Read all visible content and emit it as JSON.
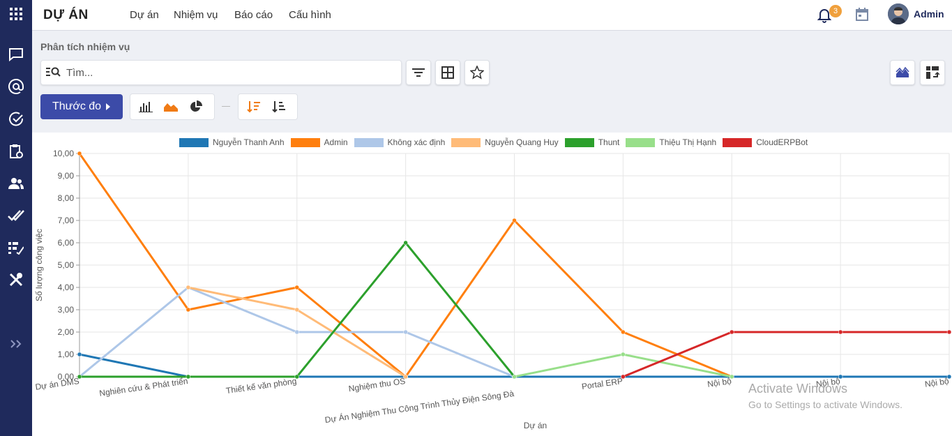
{
  "app": {
    "title": "DỰ ÁN",
    "menu": [
      "Dự án",
      "Nhiệm vụ",
      "Báo cáo",
      "Cấu hình"
    ],
    "notifications": "3",
    "user": "Admin"
  },
  "sidebar": {
    "icons": [
      "apps-grid-icon",
      "chat-icon",
      "at-sign-icon",
      "check-circle-icon",
      "clipboard-clock-icon",
      "users-icon",
      "double-check-icon",
      "task-list-icon",
      "tools-icon",
      "expand-chevrons-icon"
    ]
  },
  "control": {
    "breadcrumb": "Phân tích nhiệm vụ",
    "search_placeholder": "Tìm...",
    "measure_label": "Thước đo"
  },
  "watermark": {
    "line1": "Activate Windows",
    "line2": "Go to Settings to activate Windows."
  },
  "colors": {
    "accent": "#3c4ba8",
    "sidebar": "#1f2a5c",
    "badge": "#f0a03c"
  },
  "chart_data": {
    "type": "line",
    "xlabel": "Dự án",
    "ylabel": "Số lượng công việc",
    "ylim": [
      0,
      10
    ],
    "yticks": [
      "0,00",
      "1,00",
      "2,00",
      "3,00",
      "4,00",
      "5,00",
      "6,00",
      "7,00",
      "8,00",
      "9,00",
      "10,00"
    ],
    "categories": [
      "Dự án DMS",
      "Nghiên cứu & Phát triển",
      "Thiết kế văn phòng",
      "Nghiệm thu OS",
      "Dự Án Nghiệm Thu Công Trình Thủy Điện Sông Đà",
      "Portal ERP",
      "Nội bộ",
      "Nội bộ",
      "Nội bộ"
    ],
    "legend_position": "top",
    "grid": true,
    "series": [
      {
        "name": "Nguyễn Thanh Anh",
        "color": "#1f77b4",
        "values": [
          1,
          0,
          0,
          0,
          0,
          0,
          0,
          0,
          0
        ]
      },
      {
        "name": "Admin",
        "color": "#ff7f0e",
        "values": [
          10,
          3,
          4,
          0,
          7,
          2,
          0,
          null,
          null
        ]
      },
      {
        "name": "Không xác định",
        "color": "#aec7e8",
        "values": [
          0,
          4,
          2,
          2,
          0,
          null,
          null,
          null,
          null
        ]
      },
      {
        "name": "Nguyễn Quang Huy",
        "color": "#ffbb78",
        "values": [
          null,
          4,
          3,
          0,
          null,
          null,
          null,
          null,
          null
        ]
      },
      {
        "name": "Thunt",
        "color": "#2ca02c",
        "values": [
          0,
          0,
          0,
          6,
          0,
          null,
          null,
          null,
          null
        ]
      },
      {
        "name": "Thiệu Thị Hạnh",
        "color": "#98df8a",
        "values": [
          null,
          null,
          null,
          null,
          0,
          1,
          0,
          null,
          null
        ]
      },
      {
        "name": "CloudERPBot",
        "color": "#d62728",
        "values": [
          null,
          null,
          null,
          null,
          null,
          0,
          2,
          2,
          2
        ]
      }
    ]
  }
}
